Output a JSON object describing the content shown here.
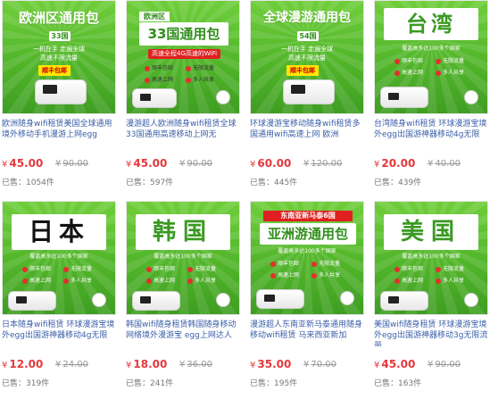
{
  "products": [
    {
      "banner_heading": "欧洲区通用包",
      "banner_sub": "33国",
      "banner_lines": [
        "一机在手 走遍全球",
        "高速不限流量"
      ],
      "banner_badge": "顺丰包邮",
      "title": "欧洲随身wifi租赁美国全球通用境外移动手机漫游上网egg",
      "price": "45.00",
      "orig_price": "90.00",
      "sold": "已售：1054件"
    },
    {
      "banner_tag": "欧洲区",
      "banner_heading": "33国通用包",
      "banner_strip": "高速全程4G高速的WiFi",
      "features": [
        "顺丰包邮",
        "无限流量",
        "高速上网",
        "多人共享"
      ],
      "title": "漫游超人欧洲随身wifi租赁全球33国通用高速移动上网无",
      "price": "45.00",
      "orig_price": "90.00",
      "sold": "已售：597件"
    },
    {
      "banner_heading": "全球漫游通用包",
      "banner_sub": "54国",
      "banner_lines": [
        "一机在手 走遍全球",
        "高速不限流量"
      ],
      "banner_badge": "顺丰包邮",
      "title": "环球漫游宝移动随身wifi租赁多国通用wifi高速上网 欧洲",
      "price": "60.00",
      "orig_price": "120.00",
      "sold": "已售：445件"
    },
    {
      "banner_heading": "台湾",
      "banner_strip": "覆盖高多达100多个国家",
      "features": [
        "顺丰包邮",
        "无限流量",
        "高速上网",
        "多人共享"
      ],
      "title": "台湾随身wifi租赁 环球漫游宝境外egg出国游神器移动4g无限",
      "price": "20.00",
      "orig_price": "40.00",
      "sold": "已售：439件"
    },
    {
      "banner_heading": "日本",
      "banner_strip": "覆盖高多达100多个国家",
      "features": [
        "顺丰包邮",
        "无限流量",
        "高速上网",
        "多人共享"
      ],
      "title": "日本随身wifi租赁 环球漫游宝境外egg出国游神器移动4g无限",
      "price": "12.00",
      "orig_price": "24.00",
      "sold": "已售：319件"
    },
    {
      "banner_heading": "韩国",
      "banner_strip": "覆盖高多达100多个国家",
      "features": [
        "顺丰包邮",
        "无限流量",
        "高速上网",
        "多人共享"
      ],
      "title": "韩国wifi随身租赁韩国随身移动网络境外漫游宝 egg上网达人",
      "price": "18.00",
      "orig_price": "36.00",
      "sold": "已售：241件"
    },
    {
      "banner_tag": "东南亚新马泰6国",
      "banner_heading": "亚洲游通用包",
      "banner_strip": "覆盖高多达100多个国家",
      "features": [
        "顺丰包邮",
        "无限流量",
        "高速上网",
        "多人共享"
      ],
      "title": "漫游超人东南亚新马泰通用随身移动wifi租赁 马来西亚新加",
      "price": "35.00",
      "orig_price": "70.00",
      "sold": "已售：195件"
    },
    {
      "banner_heading": "美国",
      "banner_strip": "覆盖高多达100多个国家",
      "features": [
        "顺丰包邮",
        "无限流量",
        "高速上网",
        "多人共享"
      ],
      "title": "美国wifi随身租赁 环球漫游宝境外egg出国游神器移动3g无限流量",
      "price": "45.00",
      "orig_price": "90.00",
      "sold": "已售：163件"
    }
  ],
  "currency": "¥",
  "colors": {
    "banner_green": "#4fb329",
    "price_red": "#e4393c",
    "link_blue": "#3a5ea8"
  },
  "icons": {
    "router": "router-icon",
    "shipping": "shipping-badge-icon"
  }
}
